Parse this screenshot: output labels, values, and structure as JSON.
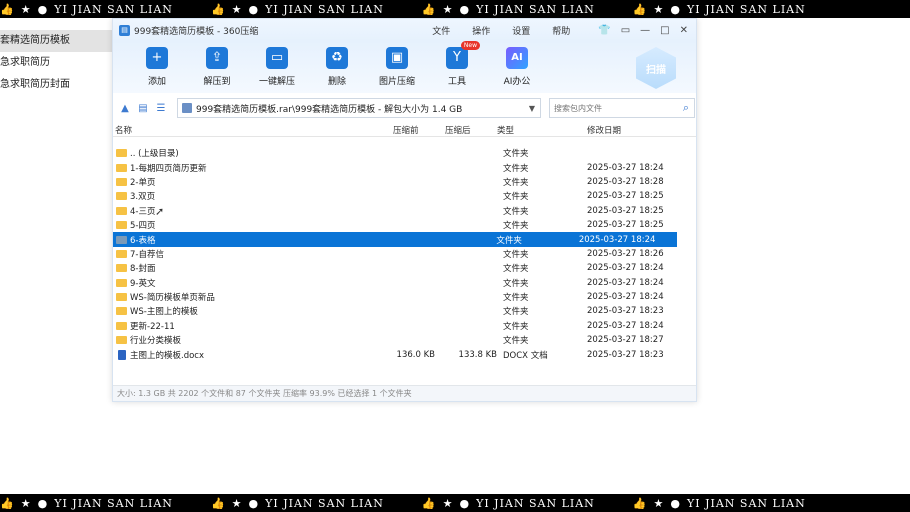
{
  "banner": {
    "segment_text": "YI JIAN SAN LIAN",
    "icons": [
      "thumbs-up-icon",
      "star-icon",
      "circle-icon"
    ],
    "icon_glyphs": [
      "👍",
      "★",
      "●"
    ]
  },
  "sidebar": {
    "items": [
      {
        "label": "套精选简历模板"
      },
      {
        "label": "急求职简历"
      },
      {
        "label": "急求职简历封面"
      }
    ]
  },
  "window": {
    "title": "999套精选简历模板 - 360压缩",
    "menu": [
      "文件",
      "操作",
      "设置",
      "帮助"
    ],
    "controls": {
      "skin": "👕",
      "menu": "▭",
      "minimize": "—",
      "maximize": "□",
      "close": "✕"
    }
  },
  "toolbar": {
    "tools": [
      {
        "label": "添加",
        "glyph": "+"
      },
      {
        "label": "解压到",
        "glyph": "⇪"
      },
      {
        "label": "一键解压",
        "glyph": "▭"
      },
      {
        "label": "删除",
        "glyph": "♻"
      },
      {
        "label": "图片压缩",
        "glyph": "▣"
      },
      {
        "label": "工具",
        "glyph": "Y",
        "badge": "New"
      },
      {
        "label": "AI办公",
        "glyph": "AI"
      }
    ],
    "scan_label": "扫描"
  },
  "address": {
    "path": "999套精选简历模板.rar\\999套精选简历模板 - 解包大小为 1.4 GB",
    "search_placeholder": "搜索包内文件"
  },
  "columns": {
    "name": "名称",
    "pre": "压缩前",
    "post": "压缩后",
    "type": "类型",
    "date": "修改日期"
  },
  "files": [
    {
      "name": ".. (上级目录)",
      "pre": "",
      "post": "",
      "type": "文件夹",
      "date": "",
      "kind": "folder"
    },
    {
      "name": "1-每期四页简历更新",
      "pre": "",
      "post": "",
      "type": "文件夹",
      "date": "2025-03-27 18:24",
      "kind": "folder"
    },
    {
      "name": "2-单页",
      "pre": "",
      "post": "",
      "type": "文件夹",
      "date": "2025-03-27 18:28",
      "kind": "folder"
    },
    {
      "name": "3.双页",
      "pre": "",
      "post": "",
      "type": "文件夹",
      "date": "2025-03-27 18:25",
      "kind": "folder"
    },
    {
      "name": "4-三页",
      "pre": "",
      "post": "",
      "type": "文件夹",
      "date": "2025-03-27 18:25",
      "kind": "folder"
    },
    {
      "name": "5-四页",
      "pre": "",
      "post": "",
      "type": "文件夹",
      "date": "2025-03-27 18:25",
      "kind": "folder"
    },
    {
      "name": "6-表格",
      "pre": "",
      "post": "",
      "type": "文件夹",
      "date": "2025-03-27 18:24",
      "kind": "folder",
      "selected": true
    },
    {
      "name": "7-自荐信",
      "pre": "",
      "post": "",
      "type": "文件夹",
      "date": "2025-03-27 18:26",
      "kind": "folder"
    },
    {
      "name": "8-封面",
      "pre": "",
      "post": "",
      "type": "文件夹",
      "date": "2025-03-27 18:24",
      "kind": "folder"
    },
    {
      "name": "9-英文",
      "pre": "",
      "post": "",
      "type": "文件夹",
      "date": "2025-03-27 18:24",
      "kind": "folder"
    },
    {
      "name": "WS-简历模板单页新品",
      "pre": "",
      "post": "",
      "type": "文件夹",
      "date": "2025-03-27 18:24",
      "kind": "folder"
    },
    {
      "name": "WS-主图上的模板",
      "pre": "",
      "post": "",
      "type": "文件夹",
      "date": "2025-03-27 18:23",
      "kind": "folder"
    },
    {
      "name": "更新-22-11",
      "pre": "",
      "post": "",
      "type": "文件夹",
      "date": "2025-03-27 18:24",
      "kind": "folder"
    },
    {
      "name": "行业分类模板",
      "pre": "",
      "post": "",
      "type": "文件夹",
      "date": "2025-03-27 18:27",
      "kind": "folder"
    },
    {
      "name": "主图上的模板.docx",
      "pre": "136.0 KB",
      "post": "133.8 KB",
      "type": "DOCX 文档",
      "date": "2025-03-27 18:23",
      "kind": "docx"
    }
  ],
  "status": "大小: 1.3 GB 共 2202 个文件和 87 个文件夹 压缩率 93.9% 已经选择 1 个文件夹"
}
